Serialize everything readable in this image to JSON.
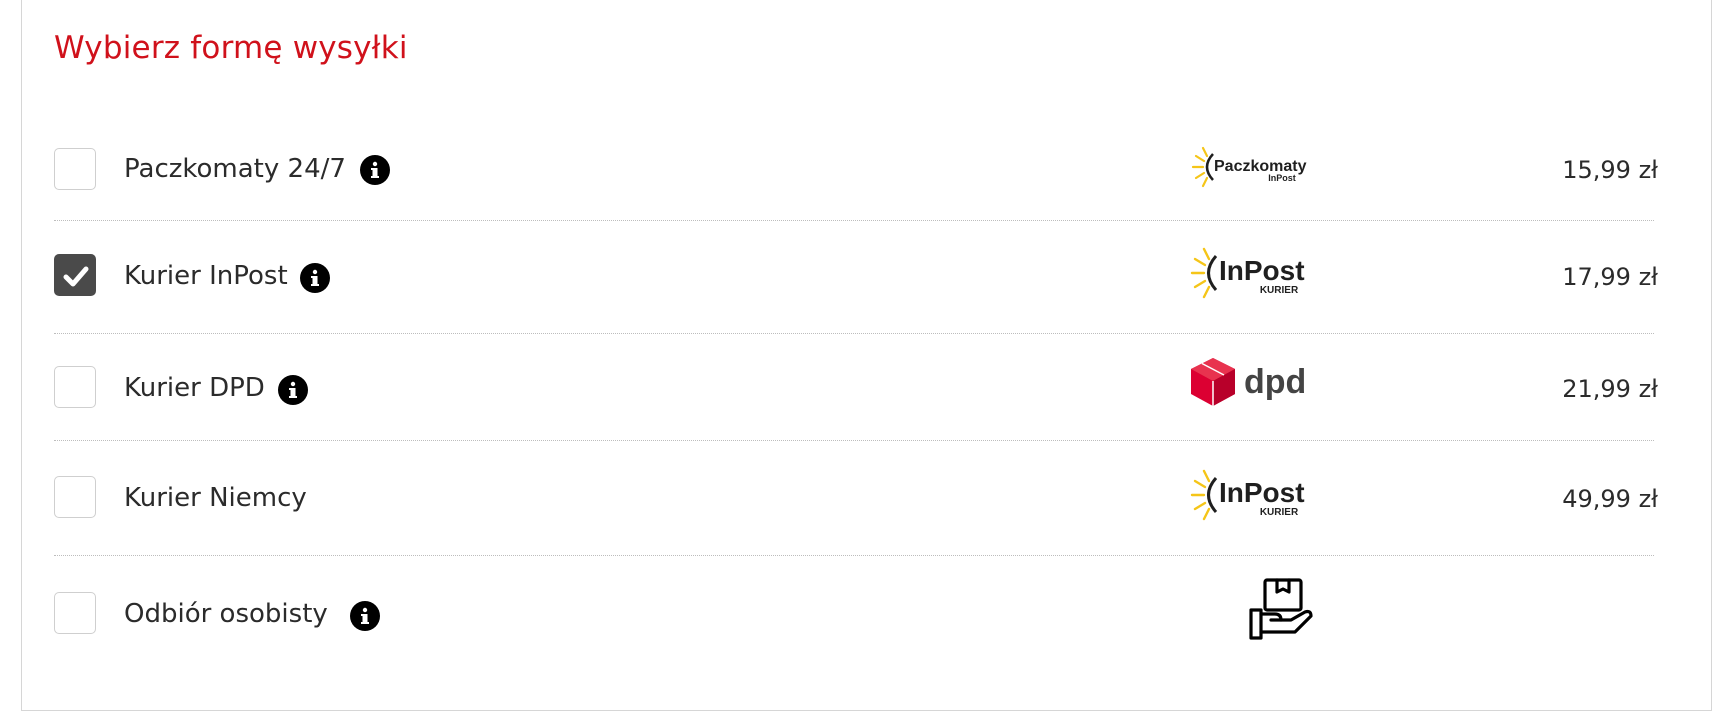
{
  "title": "Wybierz formę wysyłki",
  "options": [
    {
      "label": "Paczkomaty 24/7",
      "checked": false,
      "has_info": true,
      "logo": "paczkomaty-inpost-logo",
      "logo_text": "Paczkomaty",
      "logo_subtext": "InPost",
      "price": "15,99 zł"
    },
    {
      "label": "Kurier InPost",
      "checked": true,
      "has_info": true,
      "logo": "inpost-kurier-logo",
      "logo_text": "InPost",
      "logo_subtext": "KURIER",
      "price": "17,99 zł"
    },
    {
      "label": "Kurier DPD",
      "checked": false,
      "has_info": true,
      "logo": "dpd-logo",
      "logo_text": "dpd",
      "price": "21,99 zł"
    },
    {
      "label": "Kurier Niemcy",
      "checked": false,
      "has_info": false,
      "logo": "inpost-kurier-logo",
      "logo_text": "InPost",
      "logo_subtext": "KURIER",
      "price": "49,99 zł"
    },
    {
      "label": "Odbiór osobisty",
      "checked": false,
      "has_info": true,
      "logo": "package-in-hand-icon",
      "price": ""
    }
  ],
  "colors": {
    "title": "#d0111b",
    "checkbox_checked": "#4a4a4a",
    "inpost_yellow": "#f5c518",
    "dpd_red": "#dc0032"
  }
}
